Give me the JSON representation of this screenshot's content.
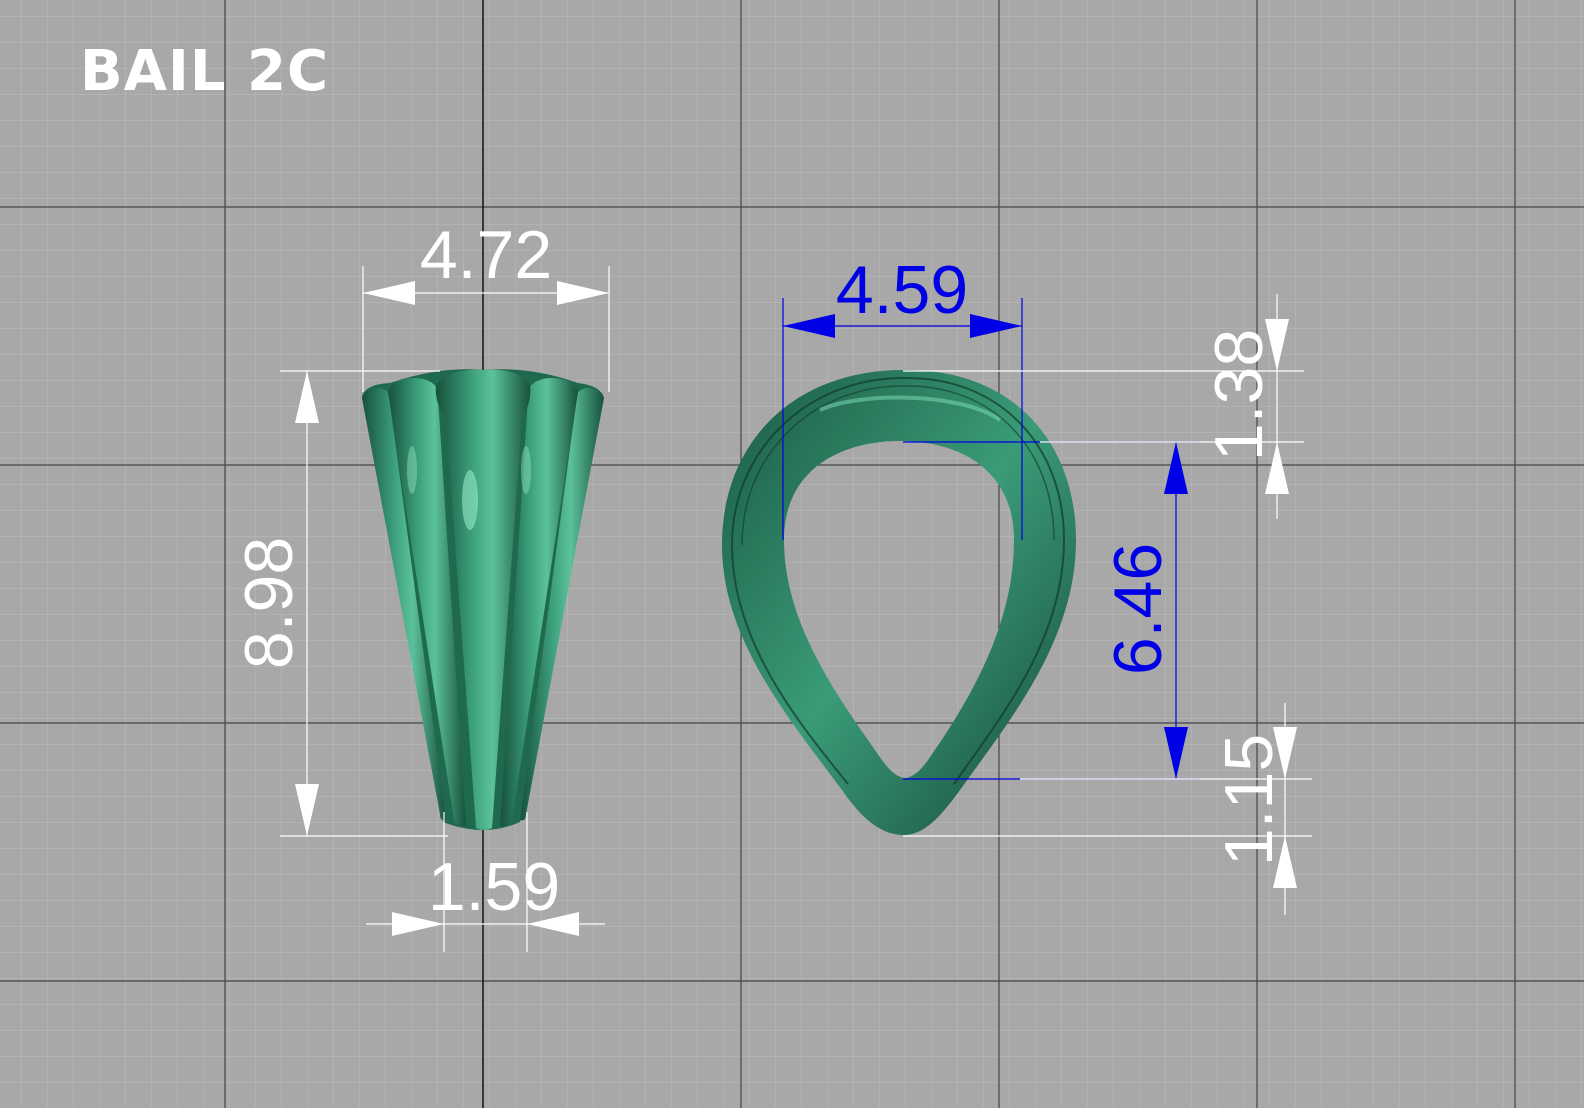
{
  "title": "BAIL 2C",
  "colors": {
    "background": "#a8a8a8",
    "grid_minor": "#bdbdbd",
    "grid_major": "#3c3c3c",
    "model_green": "#2e7e61",
    "dimension_white": "#ffffff",
    "dimension_blue": "#0000e6"
  },
  "side_view": {
    "dimensions": {
      "top_width": "4.72",
      "height": "8.98",
      "bottom_width": "1.59"
    }
  },
  "front_view": {
    "dimensions": {
      "inner_width": "4.59",
      "inner_height": "6.46",
      "top_thickness": "1.38",
      "bottom_thickness": "1.15"
    }
  }
}
